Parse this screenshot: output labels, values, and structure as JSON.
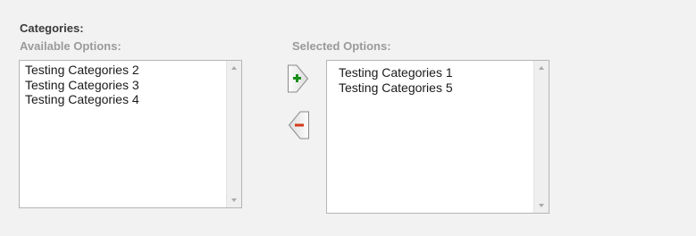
{
  "field": {
    "label": "Categories:"
  },
  "available": {
    "label": "Available Options:",
    "items": [
      "Testing Categories 2",
      "Testing Categories 3",
      "Testing Categories 4"
    ]
  },
  "selected": {
    "label": "Selected Options:",
    "items": [
      "Testing Categories 1",
      "Testing Categories 5"
    ]
  },
  "buttons": {
    "add_icon": "plus-arrow-right-icon",
    "remove_icon": "minus-arrow-left-icon",
    "add_color": "#1a8f1a",
    "remove_color": "#d33a1a"
  }
}
